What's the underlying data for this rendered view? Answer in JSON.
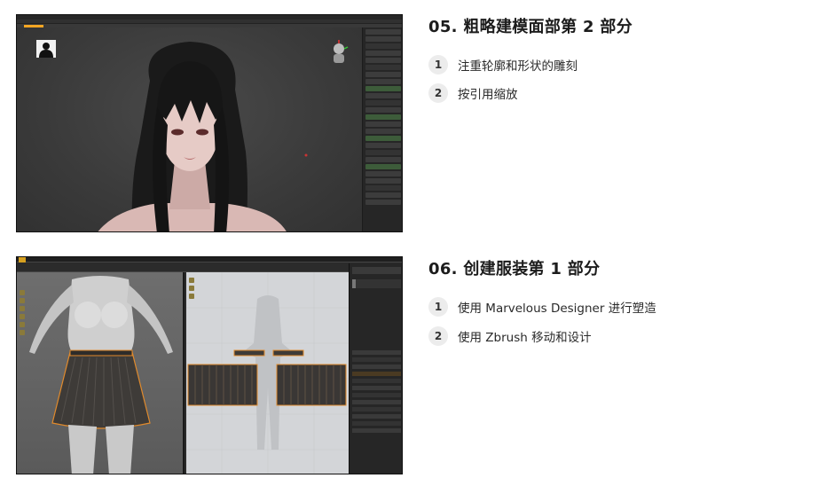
{
  "sections": [
    {
      "title": "05. 粗略建模面部第 2 部分",
      "items": [
        {
          "num": "1",
          "text": "注重轮廓和形状的雕刻"
        },
        {
          "num": "2",
          "text": "按引用缩放"
        }
      ]
    },
    {
      "title": "06. 创建服装第 1 部分",
      "items": [
        {
          "num": "1",
          "text": "使用 Marvelous Designer 进行塑造"
        },
        {
          "num": "2",
          "text": "使用 Zbrush 移动和设计"
        }
      ]
    }
  ],
  "colors": {
    "zbrush_accent": "#f5a623",
    "marvelous_logo": "#d6a020",
    "garment_outline": "#e08a2c",
    "badge_bg": "#ececec"
  }
}
